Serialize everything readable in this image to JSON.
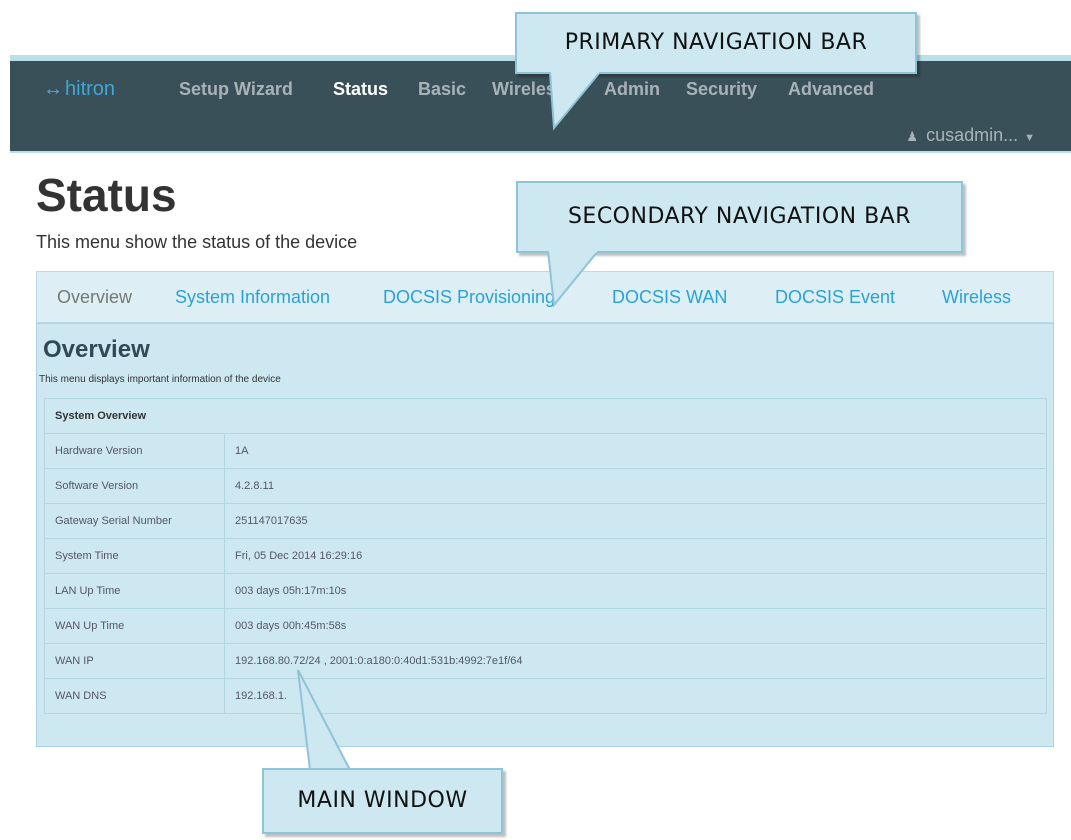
{
  "brand": {
    "glyph": "↔",
    "name": "hitron",
    "accent": "#3fa7d8"
  },
  "primary_nav": {
    "items": [
      {
        "label": "Setup Wizard",
        "active": false
      },
      {
        "label": "Status",
        "active": true
      },
      {
        "label": "Basic",
        "active": false
      },
      {
        "label": "Wireless",
        "active": false
      },
      {
        "label": "Admin",
        "active": false
      },
      {
        "label": "Security",
        "active": false
      },
      {
        "label": "Advanced",
        "active": false
      }
    ],
    "user": "cusadmin..."
  },
  "callouts": {
    "primary": "PRIMARY NAVIGATION BAR",
    "secondary": "SECONDARY NAVIGATION BAR",
    "main": "MAIN WINDOW"
  },
  "page": {
    "title": "Status",
    "description": "This menu show the status of the device"
  },
  "secondary_nav": {
    "items": [
      {
        "label": "Overview",
        "active": true
      },
      {
        "label": "System Information",
        "active": false
      },
      {
        "label": "DOCSIS Provisioning",
        "active": false
      },
      {
        "label": "DOCSIS WAN",
        "active": false
      },
      {
        "label": "DOCSIS Event",
        "active": false
      },
      {
        "label": "Wireless",
        "active": false
      }
    ]
  },
  "overview": {
    "title": "Overview",
    "description": "This menu displays important information of the device",
    "table_header": "System Overview",
    "rows": [
      {
        "label": "Hardware Version",
        "value": "1A"
      },
      {
        "label": "Software Version",
        "value": "4.2.8.11"
      },
      {
        "label": "Gateway Serial Number",
        "value": "251147017635"
      },
      {
        "label": "System Time",
        "value": "Fri, 05 Dec 2014 16:29:16"
      },
      {
        "label": "LAN Up Time",
        "value": "003 days 05h:17m:10s"
      },
      {
        "label": "WAN Up Time",
        "value": "003 days 00h:45m:58s"
      },
      {
        "label": "WAN IP",
        "value": "192.168.80.72/24 , 2001:0:a180:0:40d1:531b:4992:7e1f/64"
      },
      {
        "label": "WAN DNS",
        "value": "192.168.1."
      }
    ]
  }
}
